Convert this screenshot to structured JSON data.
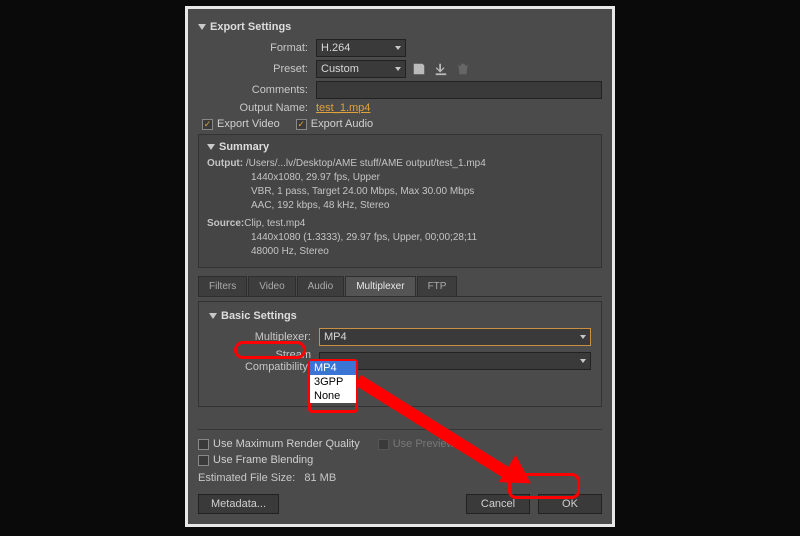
{
  "exportSettings": {
    "title": "Export Settings",
    "formatLabel": "Format:",
    "formatValue": "H.264",
    "presetLabel": "Preset:",
    "presetValue": "Custom",
    "commentsLabel": "Comments:",
    "outputNameLabel": "Output Name:",
    "outputNameValue": "test_1.mp4",
    "exportVideoLabel": "Export Video",
    "exportAudioLabel": "Export Audio"
  },
  "summary": {
    "title": "Summary",
    "outputLabel": "Output:",
    "outputPath": "/Users/...lv/Desktop/AME stuff/AME output/test_1.mp4",
    "outputRes": "1440x1080, 29.97 fps, Upper",
    "outputVbr": "VBR, 1 pass, Target 24.00 Mbps, Max 30.00 Mbps",
    "outputAudio": "AAC, 192 kbps, 48 kHz, Stereo",
    "sourceLabel": "Source:",
    "sourceClip": "Clip, test.mp4",
    "sourceRes": "1440x1080 (1.3333), 29.97 fps, Upper, 00;00;28;11",
    "sourceAudio": "48000 Hz, Stereo"
  },
  "tabs": {
    "filters": "Filters",
    "video": "Video",
    "audio": "Audio",
    "multiplexer": "Multiplexer",
    "ftp": "FTP"
  },
  "basicSettings": {
    "title": "Basic Settings",
    "multiplexerLabel": "Multiplexer:",
    "multiplexerValue": "MP4",
    "options": [
      "MP4",
      "3GPP",
      "None"
    ],
    "streamLabel": "Stream Compatibility:"
  },
  "bottom": {
    "maxRender": "Use Maximum Render Quality",
    "usePreviews": "Use Previews",
    "frameBlend": "Use Frame Blending",
    "estLabel": "Estimated File Size:",
    "estValue": "81 MB",
    "metadataBtn": "Metadata...",
    "cancelBtn": "Cancel",
    "okBtn": "OK"
  }
}
